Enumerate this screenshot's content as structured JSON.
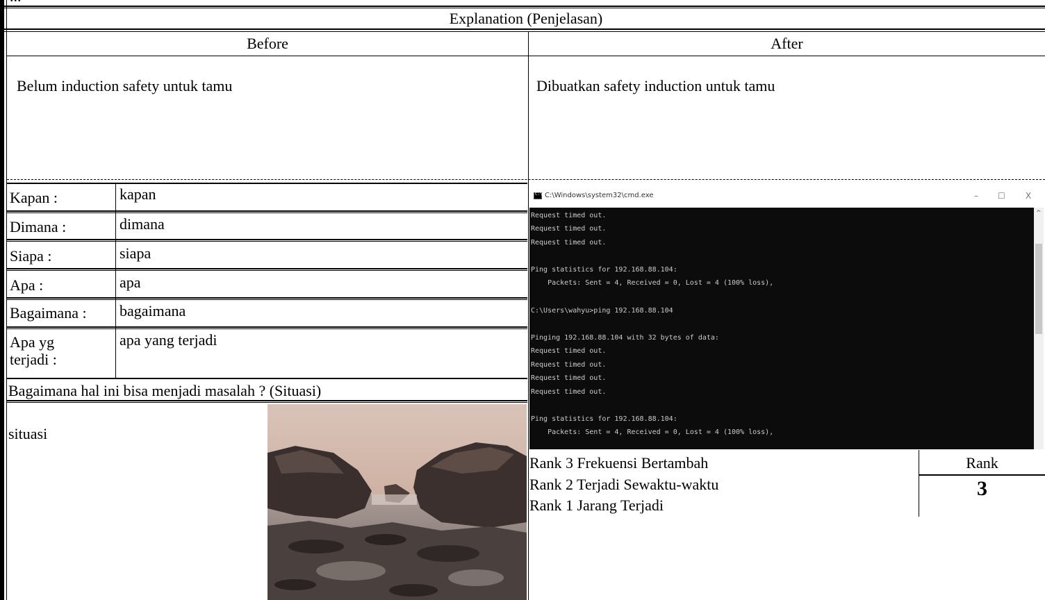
{
  "header": {
    "top_fragment": "...",
    "explanation": "Explanation (Penjelasan)",
    "before_label": "Before",
    "after_label": "After"
  },
  "before_text": "Belum induction safety untuk tamu",
  "after_text": "Dibuatkan safety induction untuk tamu",
  "fields": [
    {
      "label": "Kapan :",
      "value": "kapan"
    },
    {
      "label": "Dimana :",
      "value": "dimana"
    },
    {
      "label": "Siapa :",
      "value": "siapa"
    },
    {
      "label": "Apa :",
      "value": "apa"
    },
    {
      "label": "Bagaimana :",
      "value": "bagaimana"
    },
    {
      "label_line1": "Apa yg",
      "label_line2": "terjadi :",
      "value": "apa yang terjadi"
    }
  ],
  "situation": {
    "heading": "Bagaimana hal ini bisa menjadi masalah ? (Situasi)",
    "text": "situasi",
    "photo_icon": "rocky-beach-photo"
  },
  "cmd": {
    "title": "C:\\Windows\\system32\\cmd.exe",
    "icon": "cmd-icon",
    "min": "–",
    "max": "☐",
    "close": "X",
    "lines": [
      "Request timed out.",
      "Request timed out.",
      "Request timed out.",
      "",
      "Ping statistics for 192.168.88.104:",
      "    Packets: Sent = 4, Received = 0, Lost = 4 (100% loss),",
      "",
      "C:\\Users\\wahyu>ping 192.168.88.104",
      "",
      "Pinging 192.168.88.104 with 32 bytes of data:",
      "Request timed out.",
      "Request timed out.",
      "Request timed out.",
      "Request timed out.",
      "",
      "Ping statistics for 192.168.88.104:",
      "    Packets: Sent = 4, Received = 0, Lost = 4 (100% loss),"
    ]
  },
  "rank": {
    "items": [
      "Rank 3 Frekuensi Bertambah",
      "Rank 2 Terjadi Sewaktu-waktu",
      "Rank 1 Jarang Terjadi"
    ],
    "label": "Rank",
    "value": "3"
  }
}
